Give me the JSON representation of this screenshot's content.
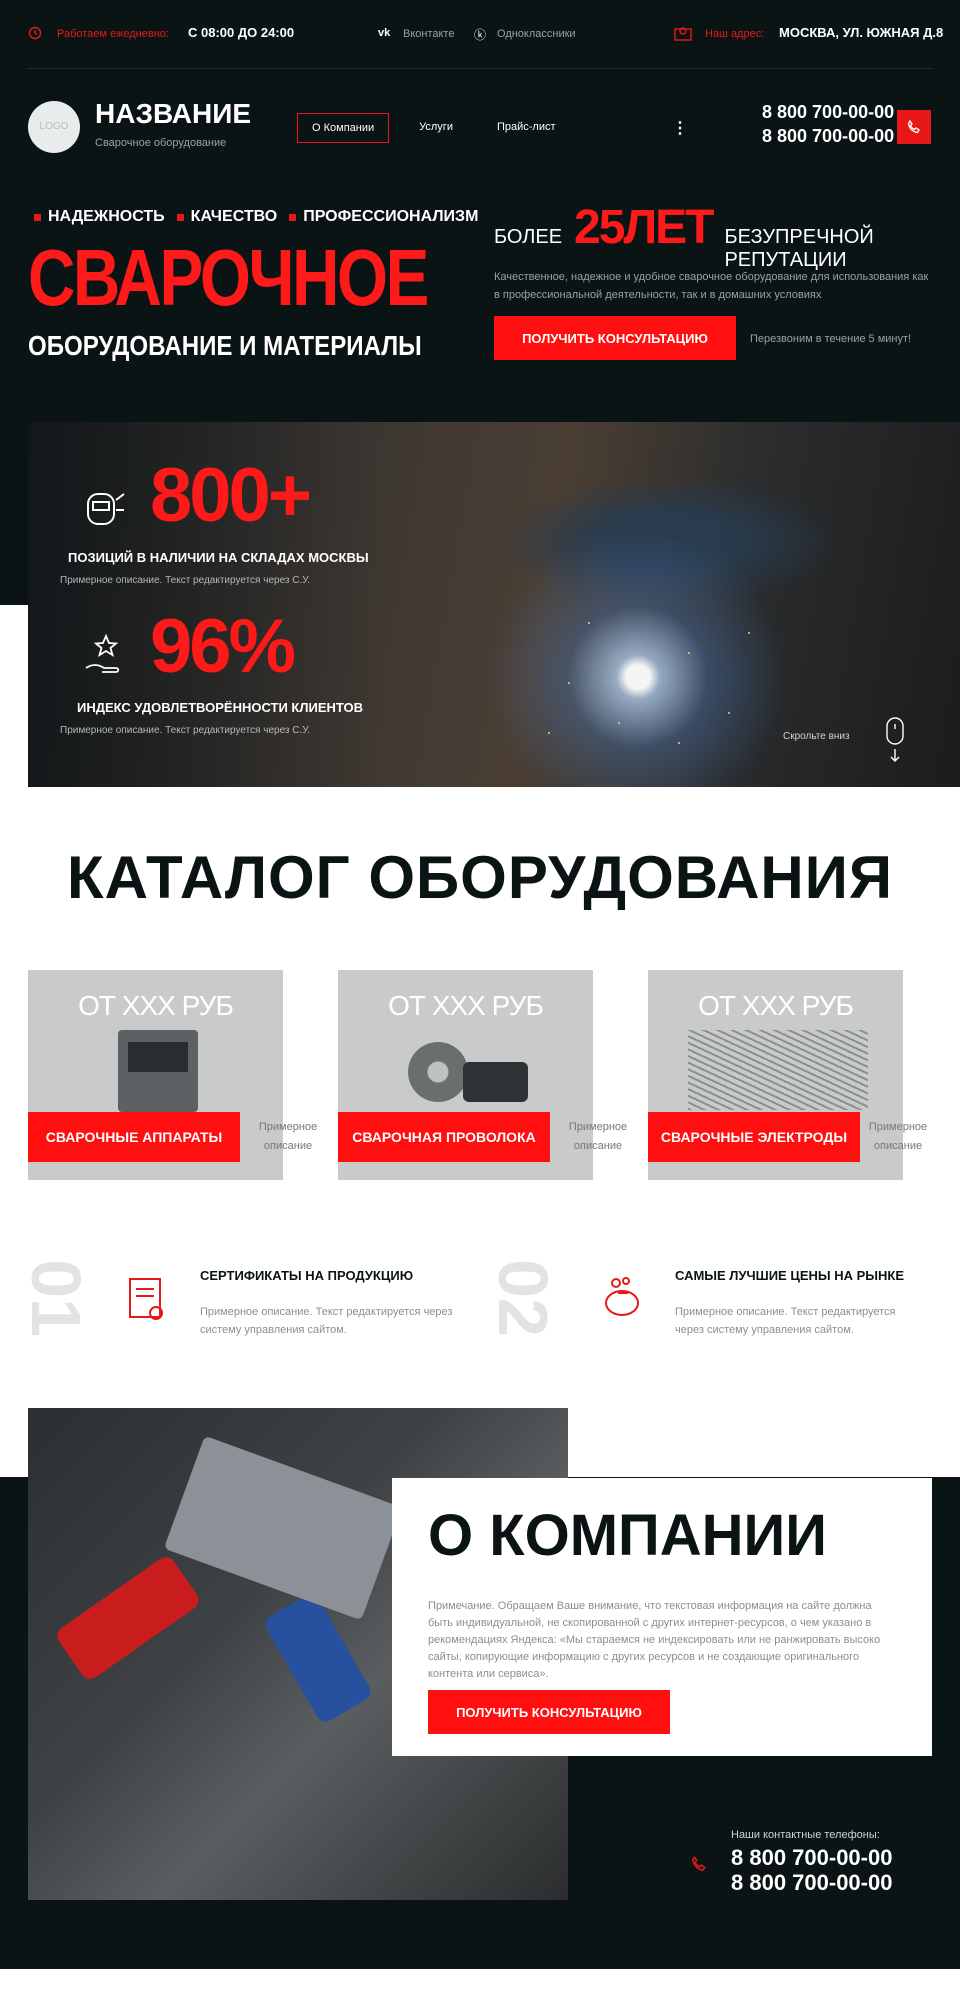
{
  "topbar": {
    "hours_label": "Работаем ежедневно:",
    "hours_value": "С 08:00 ДО 24:00",
    "social_vk": "Вконтакте",
    "social_ok": "Одноклассники",
    "address_label": "Наш адрес:",
    "address_value": "МОСКВА, УЛ. ЮЖНАЯ Д.8"
  },
  "header": {
    "logo_text": "LOGO",
    "brand_name": "НАЗВАНИЕ",
    "brand_sub": "Сварочное оборудование",
    "nav": [
      "О Компании",
      "Услуги",
      "Прайс-лист"
    ],
    "phone1": "8 800 700-00-00",
    "phone2": "8 800 700-00-00"
  },
  "hero": {
    "tags": [
      "НАДЕЖНОСТЬ",
      "КАЧЕСТВО",
      "ПРОФЕССИОНАЛИЗМ"
    ],
    "title_big": "СВАРОЧНОЕ",
    "title_sub": "ОБОРУДОВАНИЕ И МАТЕРИАЛЫ",
    "years_pre": "БОЛЕЕ",
    "years_value": "25ЛЕТ",
    "years_post": "БЕЗУПРЕЧНОЙ РЕПУТАЦИИ",
    "description": "Качественное, надежное и удобное сварочное оборудование для использования как в профессиональной деятельности, так и в домашних условиях",
    "cta": "ПОЛУЧИТЬ КОНСУЛЬТАЦИЮ",
    "callback_note": "Перезвоним в течение 5 минут!"
  },
  "stats": [
    {
      "value": "800+",
      "label": "ПОЗИЦИЙ В НАЛИЧИИ НА СКЛАДАХ МОСКВЫ",
      "desc": "Примерное описание. Текст редактируется через С.У."
    },
    {
      "value": "96%",
      "label": "ИНДЕКС УДОВЛЕТВОРЁННОСТИ КЛИЕНТОВ",
      "desc": "Примерное описание. Текст редактируется через С.У."
    }
  ],
  "scroll_hint": "Скрольте вниз",
  "catalog": {
    "title": "КАТАЛОГ ОБОРУДОВАНИЯ",
    "items": [
      {
        "price": "ОТ ХХХ РУБ",
        "label": "СВАРОЧНЫЕ АППАРАТЫ",
        "desc": "Примерное описание"
      },
      {
        "price": "ОТ ХХХ РУБ",
        "label": "СВАРОЧНАЯ ПРОВОЛОКА",
        "desc": "Примерное описание"
      },
      {
        "price": "ОТ ХХХ РУБ",
        "label": "СВАРОЧНЫЕ ЭЛЕКТРОДЫ",
        "desc": "Примерное описание"
      }
    ]
  },
  "features": [
    {
      "num": "01",
      "title": "СЕРТИФИКАТЫ НА ПРОДУКЦИЮ",
      "desc": "Примерное описание. Текст редактируется через систему управления сайтом."
    },
    {
      "num": "02",
      "title": "САМЫЕ ЛУЧШИЕ ЦЕНЫ НА РЫНКЕ",
      "desc": "Примерное описание. Текст редактируется через систему управления сайтом."
    }
  ],
  "about": {
    "title": "О КОМПАНИИ",
    "text": "Примечание. Обращаем Ваше внимание, что текстовая информация на сайте должна быть индивидуальной, не скопированной с других интернет-ресурсов, о чем указано в рекомендациях Яндекса: «Мы стараемся не индексировать или не ранжировать высоко сайты, копирующие информацию с других ресурсов и не создающие оригинального контента или сервиса».",
    "cta": "ПОЛУЧИТЬ КОНСУЛЬТАЦИЮ",
    "contacts_label": "Наши контактные телефоны:",
    "phone1": "8 800 700-00-00",
    "phone2": "8 800 700-00-00"
  },
  "colors": {
    "accent": "#ff0f0f",
    "dark": "#0b1415"
  }
}
